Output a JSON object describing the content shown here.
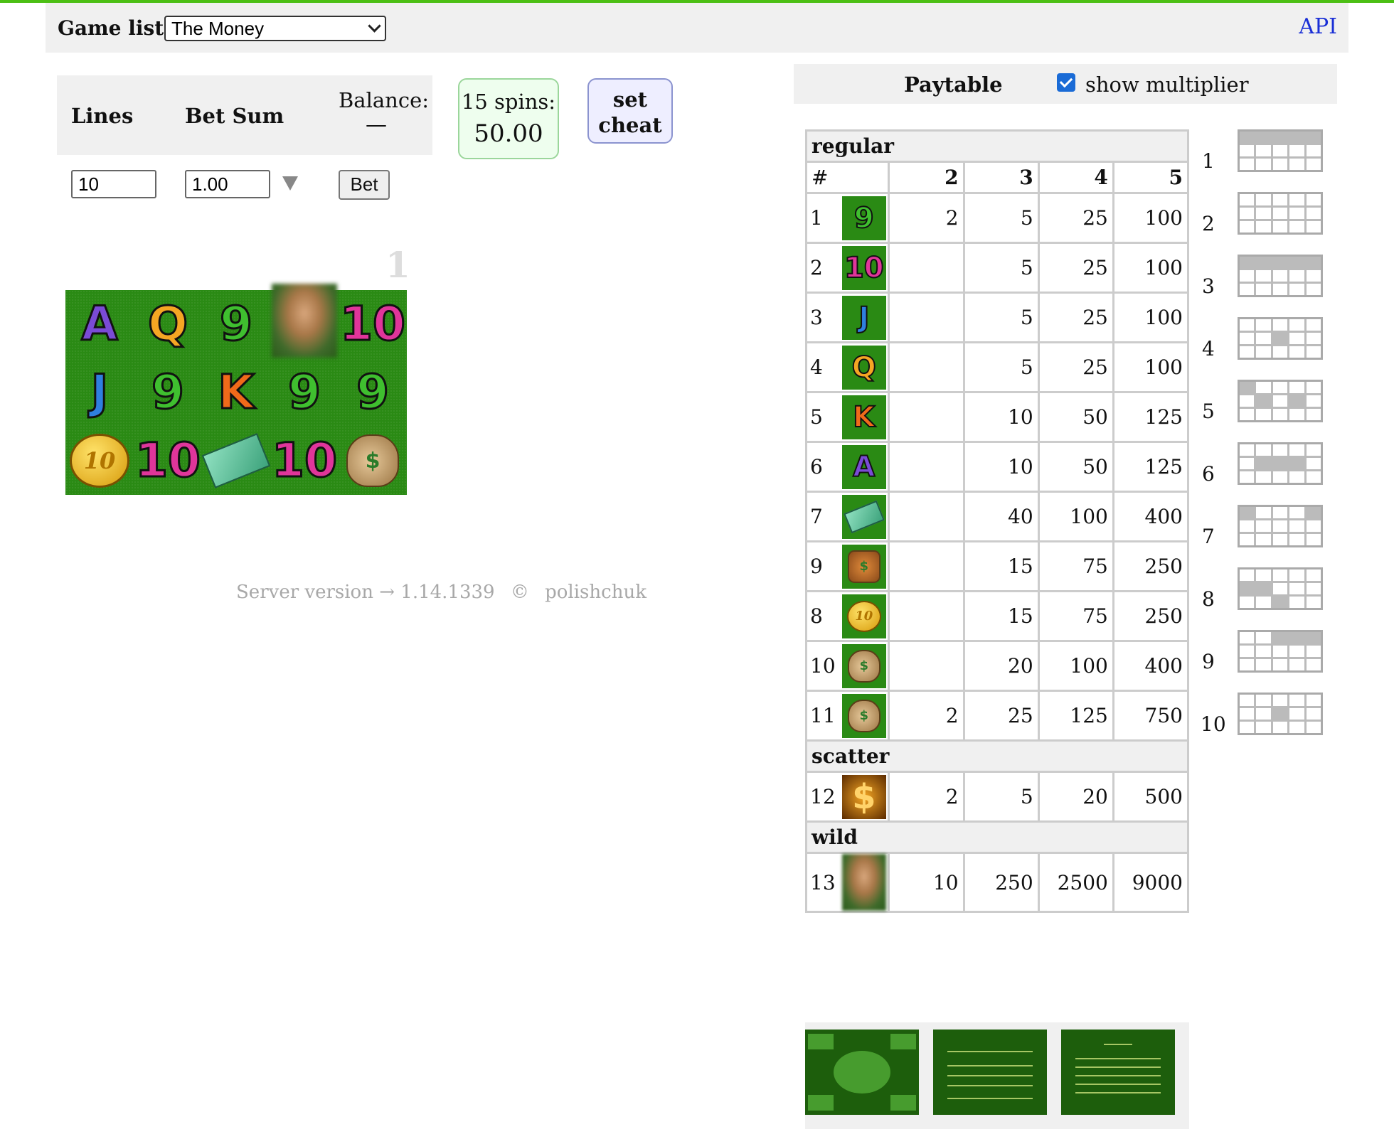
{
  "header": {
    "game_list_label": "Game list:",
    "selected_game": "The Money",
    "api_link": "API"
  },
  "controls": {
    "lines_label": "Lines",
    "bet_sum_label": "Bet Sum",
    "balance_label": "Balance:",
    "balance_value": "—",
    "lines_value": "10",
    "bet_value": "1.00",
    "bet_button": "Bet",
    "spins_label": "15 spins:",
    "spins_value": "50.00",
    "cheat_button_line1": "set",
    "cheat_button_line2": "cheat"
  },
  "reels": {
    "index_label": "1",
    "symbols": [
      [
        "A",
        "Q",
        "9",
        "wild",
        "10"
      ],
      [
        "J",
        "9",
        "K",
        "9",
        "9"
      ],
      [
        "coin",
        "10",
        "cash",
        "10",
        "bag"
      ]
    ]
  },
  "footer": {
    "server_version": "Server version → 1.14.1339",
    "copyright": "©",
    "author": "polishchuk"
  },
  "paytable": {
    "title": "Paytable",
    "show_multiplier_label": "show multiplier",
    "show_multiplier_checked": true,
    "sections": {
      "regular": "regular",
      "scatter": "scatter",
      "wild": "wild"
    },
    "columns": [
      "#",
      "2",
      "3",
      "4",
      "5"
    ],
    "regular_rows": [
      {
        "id": "1",
        "symbol": "9",
        "pays": [
          "2",
          "5",
          "25",
          "100"
        ]
      },
      {
        "id": "2",
        "symbol": "10",
        "pays": [
          "",
          "5",
          "25",
          "100"
        ]
      },
      {
        "id": "3",
        "symbol": "J",
        "pays": [
          "",
          "5",
          "25",
          "100"
        ]
      },
      {
        "id": "4",
        "symbol": "Q",
        "pays": [
          "",
          "5",
          "25",
          "100"
        ]
      },
      {
        "id": "5",
        "symbol": "K",
        "pays": [
          "",
          "10",
          "50",
          "125"
        ]
      },
      {
        "id": "6",
        "symbol": "A",
        "pays": [
          "",
          "10",
          "50",
          "125"
        ]
      },
      {
        "id": "7",
        "symbol": "cash",
        "pays": [
          "",
          "40",
          "100",
          "400"
        ]
      },
      {
        "id": "9",
        "symbol": "wallet",
        "pays": [
          "",
          "15",
          "75",
          "250"
        ]
      },
      {
        "id": "8",
        "symbol": "coin",
        "pays": [
          "",
          "15",
          "75",
          "250"
        ]
      },
      {
        "id": "10",
        "symbol": "bag",
        "pays": [
          "",
          "20",
          "100",
          "400"
        ]
      },
      {
        "id": "11",
        "symbol": "money-bag-open",
        "pays": [
          "2",
          "25",
          "125",
          "750"
        ]
      }
    ],
    "scatter_rows": [
      {
        "id": "12",
        "symbol": "dollar",
        "pays": [
          "2",
          "5",
          "20",
          "500"
        ]
      }
    ],
    "wild_rows": [
      {
        "id": "13",
        "symbol": "wild",
        "pays": [
          "10",
          "250",
          "2500",
          "9000"
        ]
      }
    ]
  },
  "lines": [
    "1",
    "2",
    "3",
    "4",
    "5",
    "6",
    "7",
    "8",
    "9",
    "10"
  ],
  "colors": {
    "accent_topline": "#4cbf14",
    "reel_bg": "#2a8a14",
    "api_link": "#1a2fd6",
    "spins_bg": "#eefeee",
    "cheat_bg": "#eeeeff"
  }
}
